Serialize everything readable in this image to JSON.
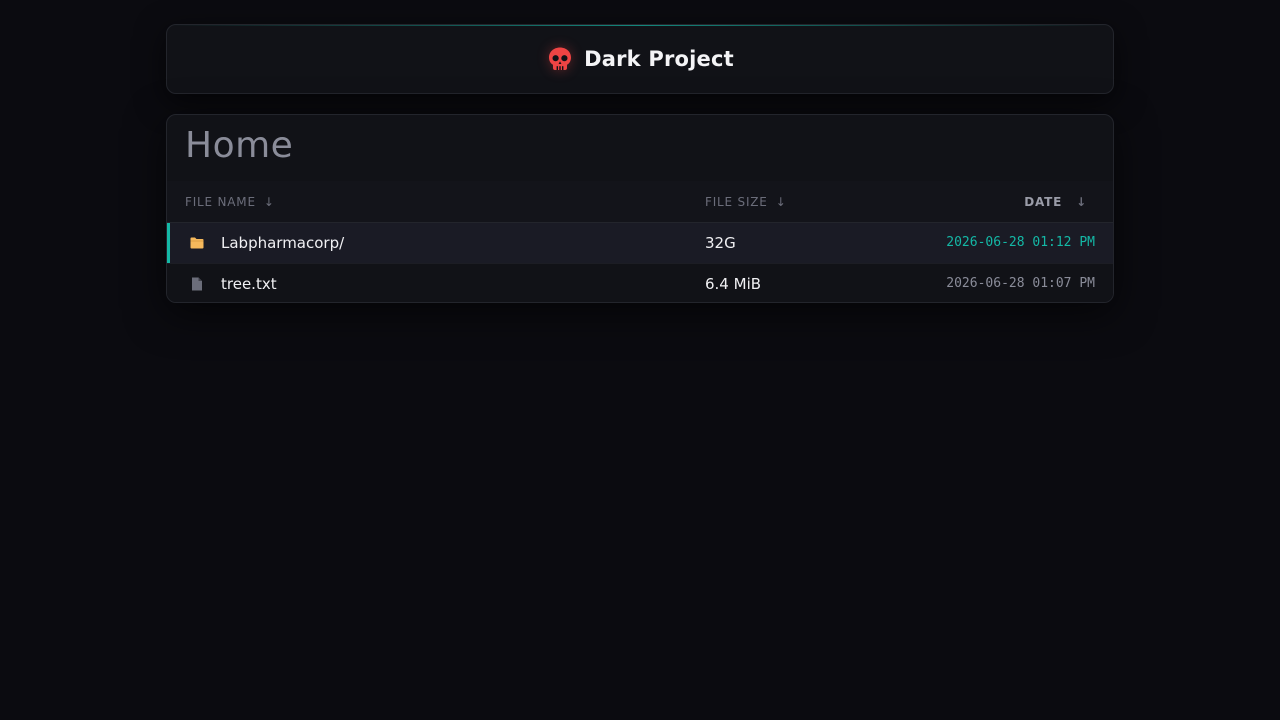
{
  "header": {
    "title": "Dark Project",
    "logo_icon": "skull-icon"
  },
  "main": {
    "title": "Home",
    "columns": [
      {
        "label": "FILE NAME",
        "sort_icon": "arrow-down-icon",
        "arrow": "↓"
      },
      {
        "label": "FILE SIZE",
        "sort_icon": "arrow-down-icon",
        "arrow": "↓"
      },
      {
        "label": "DATE",
        "sort_icon": "arrow-down-icon",
        "arrow": "↓"
      }
    ],
    "rows": [
      {
        "icon": "folder-icon",
        "name": "Labpharmacorp/",
        "size": "32G",
        "date": "2026-06-28 01:12 PM"
      },
      {
        "icon": "file-icon",
        "name": "tree.txt",
        "size": "6.4 MiB",
        "date": "2026-06-28 01:07 PM"
      }
    ]
  },
  "colors": {
    "background": "#0b0b10",
    "card": "#111217",
    "accent": "#14b8a6",
    "skull": "#ef4444",
    "folder": "#f6b95c",
    "file": "#6b6d7a"
  }
}
